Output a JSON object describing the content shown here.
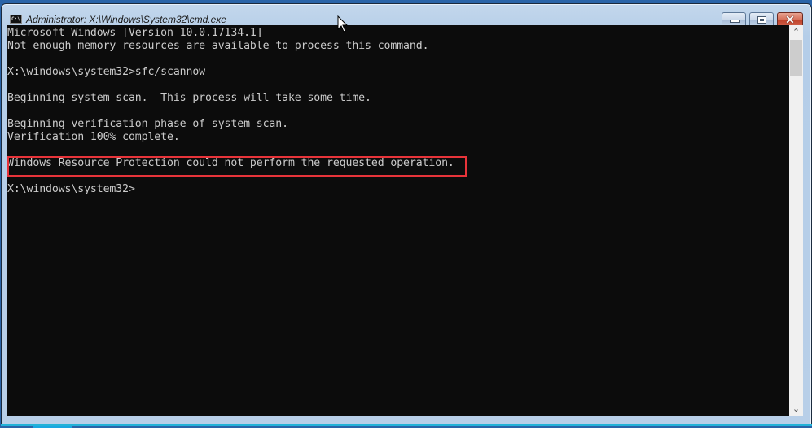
{
  "window": {
    "title": "Administrator: X:\\Windows\\System32\\cmd.exe",
    "app_icon_text": "C:\\."
  },
  "controls": {
    "minimize": "minimize",
    "maximize": "maximize",
    "close": "✕"
  },
  "console": {
    "lines": [
      "Microsoft Windows [Version 10.0.17134.1]",
      "Not enough memory resources are available to process this command.",
      "",
      "X:\\windows\\system32>sfc/scannow",
      "",
      "Beginning system scan.  This process will take some time.",
      "",
      "Beginning verification phase of system scan.",
      "Verification 100% complete.",
      "",
      "Windows Resource Protection could not perform the requested operation.",
      "",
      "X:\\windows\\system32>"
    ],
    "highlighted_line_index": 10,
    "highlight_color": "#e8343a"
  },
  "scrollbar": {
    "up": "⌃",
    "down": "⌄"
  }
}
